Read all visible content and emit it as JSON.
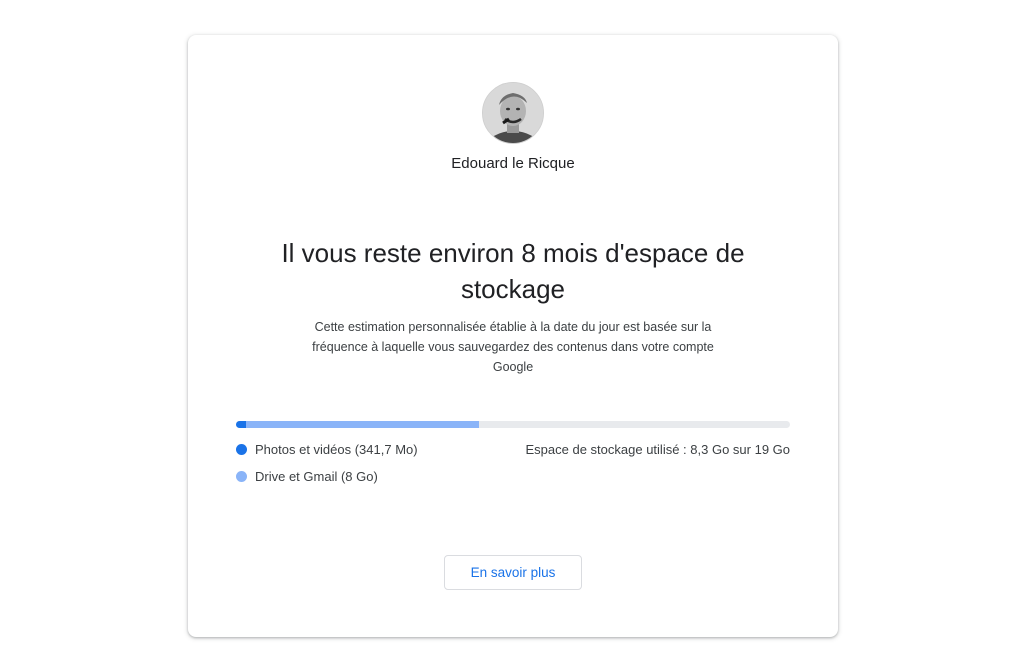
{
  "profile": {
    "name": "Edouard le Ricque"
  },
  "headline": "Il vous reste environ 8 mois d'espace de stockage",
  "description": "Cette estimation personnalisée établie à la date du jour est basée sur la fréquence à laquelle vous sauvegardez des contenus dans votre compte Google",
  "storage": {
    "used_label": "Espace de stockage utilisé : 8,3 Go sur 19 Go",
    "used_total_gb": 8.3,
    "capacity_gb": 19,
    "segments": [
      {
        "label": "Photos et vidéos (341,7 Mo)",
        "value_gb": 0.3417,
        "color": "#1a73e8"
      },
      {
        "label": "Drive et Gmail (8 Go)",
        "value_gb": 8,
        "color": "#8ab4f8"
      }
    ],
    "track_color": "#e8eaed"
  },
  "actions": {
    "learn_more_label": "En savoir plus"
  },
  "colors": {
    "accent": "#1a73e8"
  }
}
